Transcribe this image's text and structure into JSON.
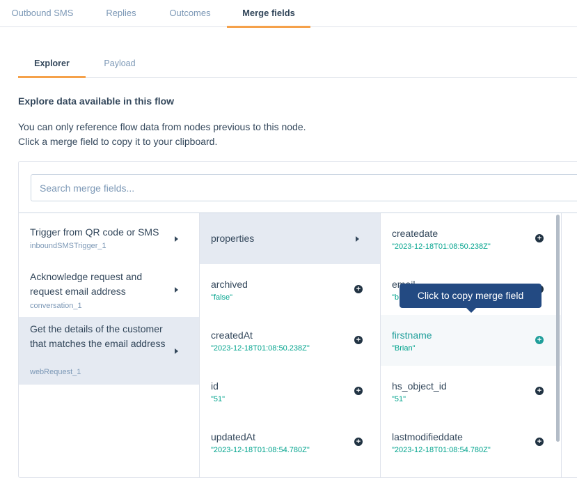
{
  "top_tabs": [
    "Outbound SMS",
    "Replies",
    "Outcomes",
    "Merge fields"
  ],
  "sub_tabs": [
    "Explorer",
    "Payload"
  ],
  "section_title": "Explore data available in this flow",
  "description": [
    "You can only reference flow data from nodes previous to this node.",
    "Click a merge field to copy it to your clipboard."
  ],
  "search": {
    "placeholder": "Search merge fields..."
  },
  "nodes": [
    {
      "title": "Trigger from QR code or SMS",
      "sub": "inboundSMSTrigger_1"
    },
    {
      "title": "Acknowledge request and request email address",
      "sub": "conversation_1"
    },
    {
      "title": "Get the details of the customer that matches the email address",
      "sub": "webRequest_1"
    }
  ],
  "col2": [
    {
      "name": "properties",
      "value": ""
    },
    {
      "name": "archived",
      "value": "\"false\""
    },
    {
      "name": "createdAt",
      "value": "\"2023-12-18T01:08:50.238Z\""
    },
    {
      "name": "id",
      "value": "\"51\""
    },
    {
      "name": "updatedAt",
      "value": "\"2023-12-18T01:08:54.780Z\""
    }
  ],
  "col3": [
    {
      "name": "createdate",
      "value": "\"2023-12-18T01:08:50.238Z\""
    },
    {
      "name": "email",
      "value": "\"b"
    },
    {
      "name": "firstname",
      "value": "\"Brian\""
    },
    {
      "name": "hs_object_id",
      "value": "\"51\""
    },
    {
      "name": "lastmodifieddate",
      "value": "\"2023-12-18T01:08:54.780Z\""
    }
  ],
  "tooltip": "Click to copy merge field",
  "colors": {
    "accent": "#f5a14a",
    "teal": "#1f9e9a",
    "tooltip": "#234a82",
    "selected": "#e5eaf2"
  }
}
